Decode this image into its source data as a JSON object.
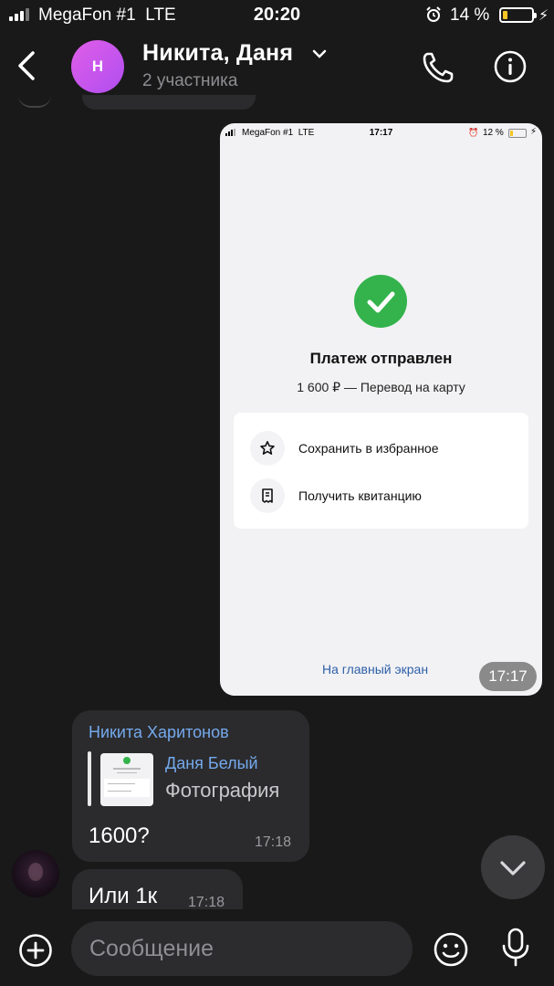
{
  "status_bar": {
    "carrier": "MegaFon #1",
    "network": "LTE",
    "time": "20:20",
    "battery": "14 %",
    "battery_level": 0.14,
    "icons": [
      "signal-icon",
      "alarm-icon",
      "battery-icon",
      "charging-icon"
    ]
  },
  "header": {
    "avatar_letter": "Н",
    "title": "Никита, Даня",
    "subtitle": "2 участника",
    "icons": [
      "back-chevron-icon",
      "chevron-down-icon",
      "phone-icon",
      "info-icon"
    ]
  },
  "image_message": {
    "screenshot": {
      "carrier": "MegaFon #1",
      "network": "LTE",
      "time": "17:17",
      "battery": "12 %",
      "battery_level": 0.12,
      "title": "Платеж отправлен",
      "subtitle": "1 600 ₽ — Перевод на карту",
      "actions": [
        {
          "label": "Сохранить в избранное",
          "icon": "star-icon"
        },
        {
          "label": "Получить квитанцию",
          "icon": "receipt-icon"
        }
      ],
      "home_link": "На главный экран"
    },
    "time": "17:17"
  },
  "messages": [
    {
      "sender": "Никита Харитонов",
      "reply_to": {
        "name": "Даня Белый",
        "type": "Фотография"
      },
      "text": "1600?",
      "time": "17:18"
    },
    {
      "text": "Или 1к",
      "time": "17:18"
    }
  ],
  "input": {
    "placeholder": "Сообщение",
    "icons": [
      "plus-icon",
      "emoji-icon",
      "microphone-icon"
    ]
  },
  "colors": {
    "background": "#191919",
    "bubble": "#2b2b2d",
    "link_blue": "#74a9ec",
    "avatar_purple": "#c657ec",
    "success_green": "#34b34c",
    "battery_yellow": "#f4c524"
  }
}
